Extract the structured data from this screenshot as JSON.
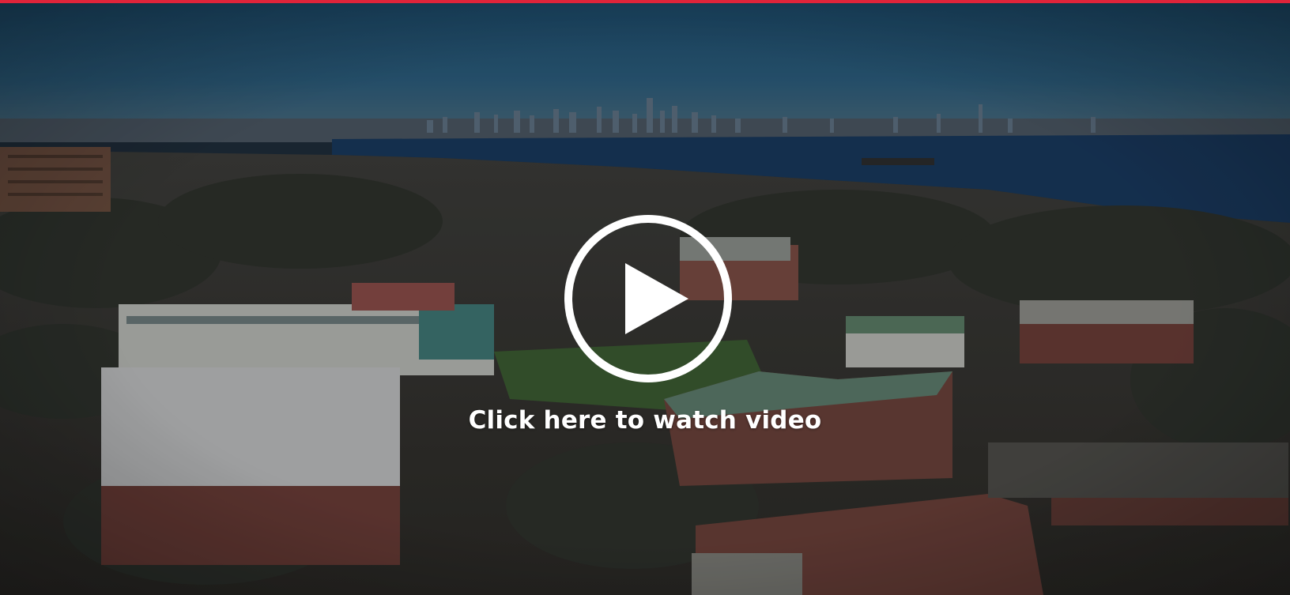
{
  "video": {
    "cta_label": "Click here to watch video",
    "play_icon": "play-circle-icon"
  },
  "colors": {
    "accent_bar": "#e0243a",
    "cta_text": "#ffffff",
    "play_icon": "#ffffff"
  }
}
